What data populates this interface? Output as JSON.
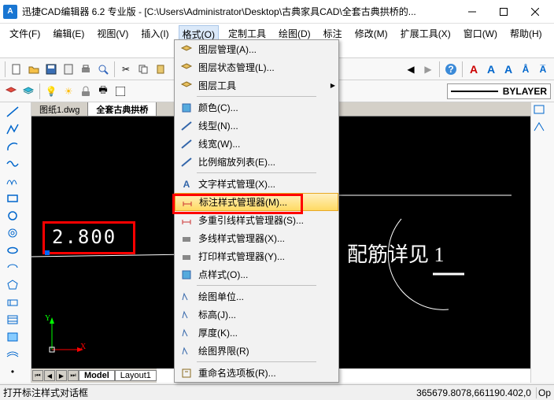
{
  "title": "迅捷CAD编辑器 6.2 专业版  - [C:\\Users\\Administrator\\Desktop\\古典家具CAD\\全套古典拱桥的...",
  "app_icon_label": "A",
  "menubar": [
    "文件(F)",
    "编辑(E)",
    "视图(V)",
    "插入(I)",
    "格式(O)",
    "定制工具",
    "绘图(D)",
    "标注",
    "修改(M)",
    "扩展工具(X)",
    "窗口(W)",
    "帮助(H)"
  ],
  "active_menu_index": 4,
  "dropdown": {
    "items": [
      {
        "label": "图层管理(A)...",
        "sep_after": false
      },
      {
        "label": "图层状态管理(L)...",
        "sep_after": false
      },
      {
        "label": "图层工具",
        "arrow": true,
        "sep_after": true
      },
      {
        "label": "颜色(C)...",
        "sep_after": false
      },
      {
        "label": "线型(N)...",
        "sep_after": false
      },
      {
        "label": "线宽(W)...",
        "sep_after": false
      },
      {
        "label": "比例缩放列表(E)...",
        "sep_after": true
      },
      {
        "label": "文字样式管理(X)...",
        "sep_after": false
      },
      {
        "label": "标注样式管理器(M)...",
        "highlighted": true,
        "sep_after": false
      },
      {
        "label": "多重引线样式管理器(S)...",
        "sep_after": false
      },
      {
        "label": "多线样式管理器(X)...",
        "sep_after": false
      },
      {
        "label": "打印样式管理器(Y)...",
        "sep_after": false
      },
      {
        "label": "点样式(O)...",
        "sep_after": true
      },
      {
        "label": "绘图单位...",
        "sep_after": false
      },
      {
        "label": "标高(J)...",
        "sep_after": false
      },
      {
        "label": "厚度(K)...",
        "sep_after": false
      },
      {
        "label": "绘图界限(R)",
        "sep_after": true
      },
      {
        "label": "重命名选项板(R)...",
        "sep_after": false
      }
    ]
  },
  "tabs": {
    "documents": [
      "图纸1.dwg",
      "全套古典拱桥"
    ],
    "active_doc": 1,
    "bottom": [
      "Model",
      "Layout1"
    ]
  },
  "canvas": {
    "dimension_value": "2.800",
    "annotation_text": "配筋详见 1",
    "ucs": {
      "x": "X",
      "y": "Y"
    }
  },
  "bylayer": "BYLAYER",
  "statusbar": {
    "hint": "打开标注样式对话框",
    "coords": "365679.8078,661190.402,0",
    "extra": "Op"
  }
}
